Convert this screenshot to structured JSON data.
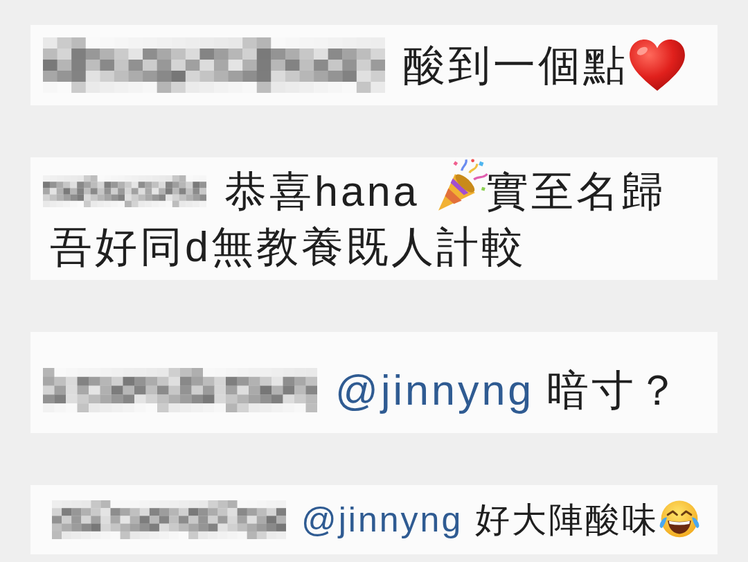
{
  "comments": [
    {
      "author_pixelated": true,
      "lines": [
        [
          {
            "kind": "text",
            "text": "酸到一個點"
          },
          {
            "kind": "heart"
          }
        ]
      ]
    },
    {
      "author_pixelated": true,
      "lines": [
        [
          {
            "kind": "text",
            "text": "恭喜hana"
          },
          {
            "kind": "popper"
          },
          {
            "kind": "text",
            "text": "實至名歸"
          }
        ],
        [
          {
            "kind": "text",
            "text": "吾好同d無教養既人計較"
          }
        ]
      ]
    },
    {
      "author_pixelated": true,
      "lines": [
        [
          {
            "kind": "mention",
            "text": "@jinnyng"
          },
          {
            "kind": "text",
            "text": "暗寸？"
          }
        ]
      ]
    },
    {
      "author_pixelated": true,
      "lines": [
        [
          {
            "kind": "mention",
            "text": "@jinnyng"
          },
          {
            "kind": "text",
            "text": "好大陣酸味"
          },
          {
            "kind": "laughter"
          }
        ]
      ]
    }
  ]
}
